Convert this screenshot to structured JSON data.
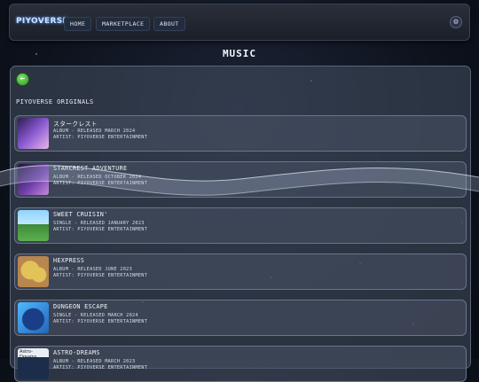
{
  "header": {
    "logo": "PIYOVERSE",
    "nav": [
      "HOME",
      "MARKETPLACE",
      "ABOUT"
    ],
    "settings_icon": "gear-icon"
  },
  "page": {
    "title": "MUSIC"
  },
  "section": {
    "title": "PIYOVERSE ORIGINALS"
  },
  "albums": [
    {
      "title": "スタークレスト",
      "release": "ALBUM - RELEASED MARCH 2024",
      "artist": "ARTIST: PIYOVERSE ENTERTAINMENT",
      "cover": "#6d4aa8"
    },
    {
      "title": "STARCREST ADVENTURE",
      "release": "ALBUM - RELEASED OCTOBER 2024",
      "artist": "ARTIST: PIYOVERSE ENTERTAINMENT",
      "cover": "#5b3d8c"
    },
    {
      "title": "SWEET CRUISIN'",
      "release": "SINGLE - RELEASED JANUARY 2023",
      "artist": "ARTIST: PIYOVERSE ENTERTAINMENT",
      "cover": "#4aa8e0"
    },
    {
      "title": "HEXPRESS",
      "release": "ALBUM - RELEASED JUNE 2023",
      "artist": "ARTIST: PIYOVERSE ENTERTAINMENT",
      "cover": "#b8864e"
    },
    {
      "title": "DUNGEON ESCAPE",
      "release": "SINGLE - RELEASED MARCH 2024",
      "artist": "ARTIST: PIYOVERSE ENTERTAINMENT",
      "cover": "#2f78c8"
    },
    {
      "title": "ASTRO-DREAMS",
      "release": "ALBUM - RELEASED MARCH 2023",
      "artist": "ARTIST: PIYOVERSE ENTERTAINMENT",
      "cover": "#1b2d4a",
      "cover_label": "Astro-Dreams"
    }
  ]
}
